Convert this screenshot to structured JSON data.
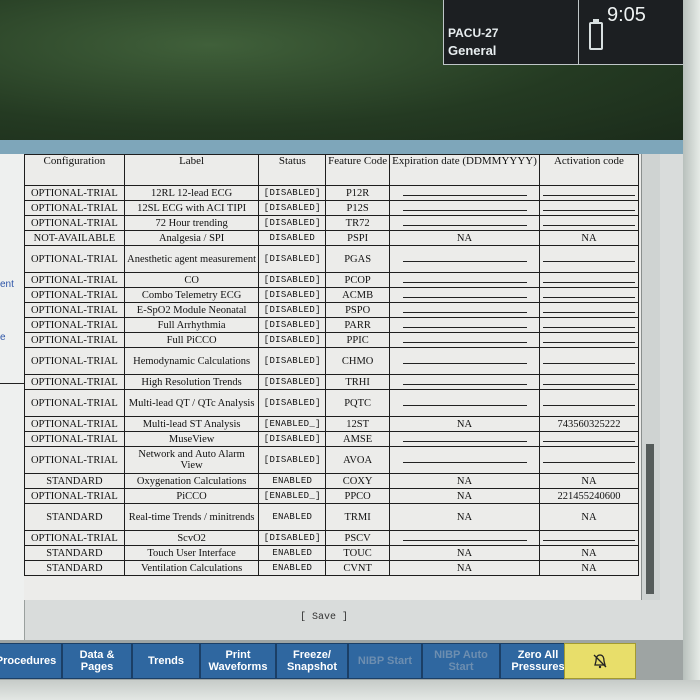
{
  "header": {
    "bed": "PACU-27",
    "unit": "General",
    "time": "9:05"
  },
  "left_panel": {
    "labels": [
      "ent",
      "e"
    ]
  },
  "table": {
    "columns": [
      "Configuration",
      "Label",
      "Status",
      "Feature Code",
      "Expiration date (DDMMYYYY)",
      "Activation code"
    ],
    "rows": [
      {
        "config": "OPTIONAL-TRIAL",
        "label": "12RL 12-lead ECG",
        "status": "[DISABLED]",
        "code": "P12R",
        "exp": "",
        "act": ""
      },
      {
        "config": "OPTIONAL-TRIAL",
        "label": "12SL ECG with ACI TIPI",
        "status": "[DISABLED]",
        "code": "P12S",
        "exp": "",
        "act": ""
      },
      {
        "config": "OPTIONAL-TRIAL",
        "label": "72 Hour trending",
        "status": "[DISABLED]",
        "code": "TR72",
        "exp": "",
        "act": ""
      },
      {
        "config": "NOT-AVAILABLE",
        "label": "Analgesia / SPI",
        "status": "DISABLED",
        "code": "PSPI",
        "exp": "NA",
        "act": "NA"
      },
      {
        "config": "OPTIONAL-TRIAL",
        "label": "Anesthetic agent measurement",
        "status": "[DISABLED]",
        "code": "PGAS",
        "exp": "",
        "act": ""
      },
      {
        "config": "OPTIONAL-TRIAL",
        "label": "CO",
        "status": "[DISABLED]",
        "code": "PCOP",
        "exp": "",
        "act": ""
      },
      {
        "config": "OPTIONAL-TRIAL",
        "label": "Combo Telemetry ECG",
        "status": "[DISABLED]",
        "code": "ACMB",
        "exp": "",
        "act": ""
      },
      {
        "config": "OPTIONAL-TRIAL",
        "label": "E-SpO2 Module Neonatal",
        "status": "[DISABLED]",
        "code": "PSPO",
        "exp": "",
        "act": ""
      },
      {
        "config": "OPTIONAL-TRIAL",
        "label": "Full Arrhythmia",
        "status": "[DISABLED]",
        "code": "PARR",
        "exp": "",
        "act": ""
      },
      {
        "config": "OPTIONAL-TRIAL",
        "label": "Full PiCCO",
        "status": "[DISABLED]",
        "code": "PPIC",
        "exp": "",
        "act": ""
      },
      {
        "config": "OPTIONAL-TRIAL",
        "label": "Hemodynamic Calculations",
        "status": "[DISABLED]",
        "code": "CHMO",
        "exp": "",
        "act": ""
      },
      {
        "config": "OPTIONAL-TRIAL",
        "label": "High Resolution Trends",
        "status": "[DISABLED]",
        "code": "TRHI",
        "exp": "",
        "act": ""
      },
      {
        "config": "OPTIONAL-TRIAL",
        "label": "Multi-lead QT / QTc Analysis",
        "status": "[DISABLED]",
        "code": "PQTC",
        "exp": "",
        "act": ""
      },
      {
        "config": "OPTIONAL-TRIAL",
        "label": "Multi-lead ST Analysis",
        "status": "[ENABLED_]",
        "code": "12ST",
        "exp": "NA",
        "act": "743560325222"
      },
      {
        "config": "OPTIONAL-TRIAL",
        "label": "MuseView",
        "status": "[DISABLED]",
        "code": "AMSE",
        "exp": "",
        "act": ""
      },
      {
        "config": "OPTIONAL-TRIAL",
        "label": "Network and Auto Alarm View",
        "status": "[DISABLED]",
        "code": "AVOA",
        "exp": "",
        "act": ""
      },
      {
        "config": "STANDARD",
        "label": "Oxygenation Calculations",
        "status": "ENABLED",
        "code": "COXY",
        "exp": "NA",
        "act": "NA"
      },
      {
        "config": "OPTIONAL-TRIAL",
        "label": "PiCCO",
        "status": "[ENABLED_]",
        "code": "PPCO",
        "exp": "NA",
        "act": "221455240600"
      },
      {
        "config": "STANDARD",
        "label": "Real-time Trends / minitrends",
        "status": "ENABLED",
        "code": "TRMI",
        "exp": "NA",
        "act": "NA"
      },
      {
        "config": "OPTIONAL-TRIAL",
        "label": "ScvO2",
        "status": "[DISABLED]",
        "code": "PSCV",
        "exp": "",
        "act": ""
      },
      {
        "config": "STANDARD",
        "label": "Touch User Interface",
        "status": "ENABLED",
        "code": "TOUC",
        "exp": "NA",
        "act": "NA"
      },
      {
        "config": "STANDARD",
        "label": "Ventilation Calculations",
        "status": "ENABLED",
        "code": "CVNT",
        "exp": "NA",
        "act": "NA"
      }
    ]
  },
  "save_label": "[ Save ]",
  "buttons": [
    {
      "name": "procedures-button",
      "label": "Procedures",
      "disabled": false
    },
    {
      "name": "data-pages-button",
      "label": "Data & Pages",
      "disabled": false
    },
    {
      "name": "trends-button",
      "label": "Trends",
      "disabled": false
    },
    {
      "name": "print-waveforms-button",
      "label": "Print Waveforms",
      "disabled": false
    },
    {
      "name": "freeze-snapshot-button",
      "label": "Freeze/ Snapshot",
      "disabled": false
    },
    {
      "name": "nibp-start-button",
      "label": "NIBP Start",
      "disabled": true
    },
    {
      "name": "nibp-auto-start-button",
      "label": "NIBP Auto Start",
      "disabled": true
    },
    {
      "name": "zero-all-pressures-button",
      "label": "Zero All Pressures",
      "disabled": false
    },
    {
      "name": "alarm-silence-button",
      "label": "",
      "disabled": false
    }
  ],
  "colors": {
    "button_blue": "#2f67a0",
    "alarm_yellow": "#e8de6a",
    "title_bar": "#7ea6ba"
  }
}
